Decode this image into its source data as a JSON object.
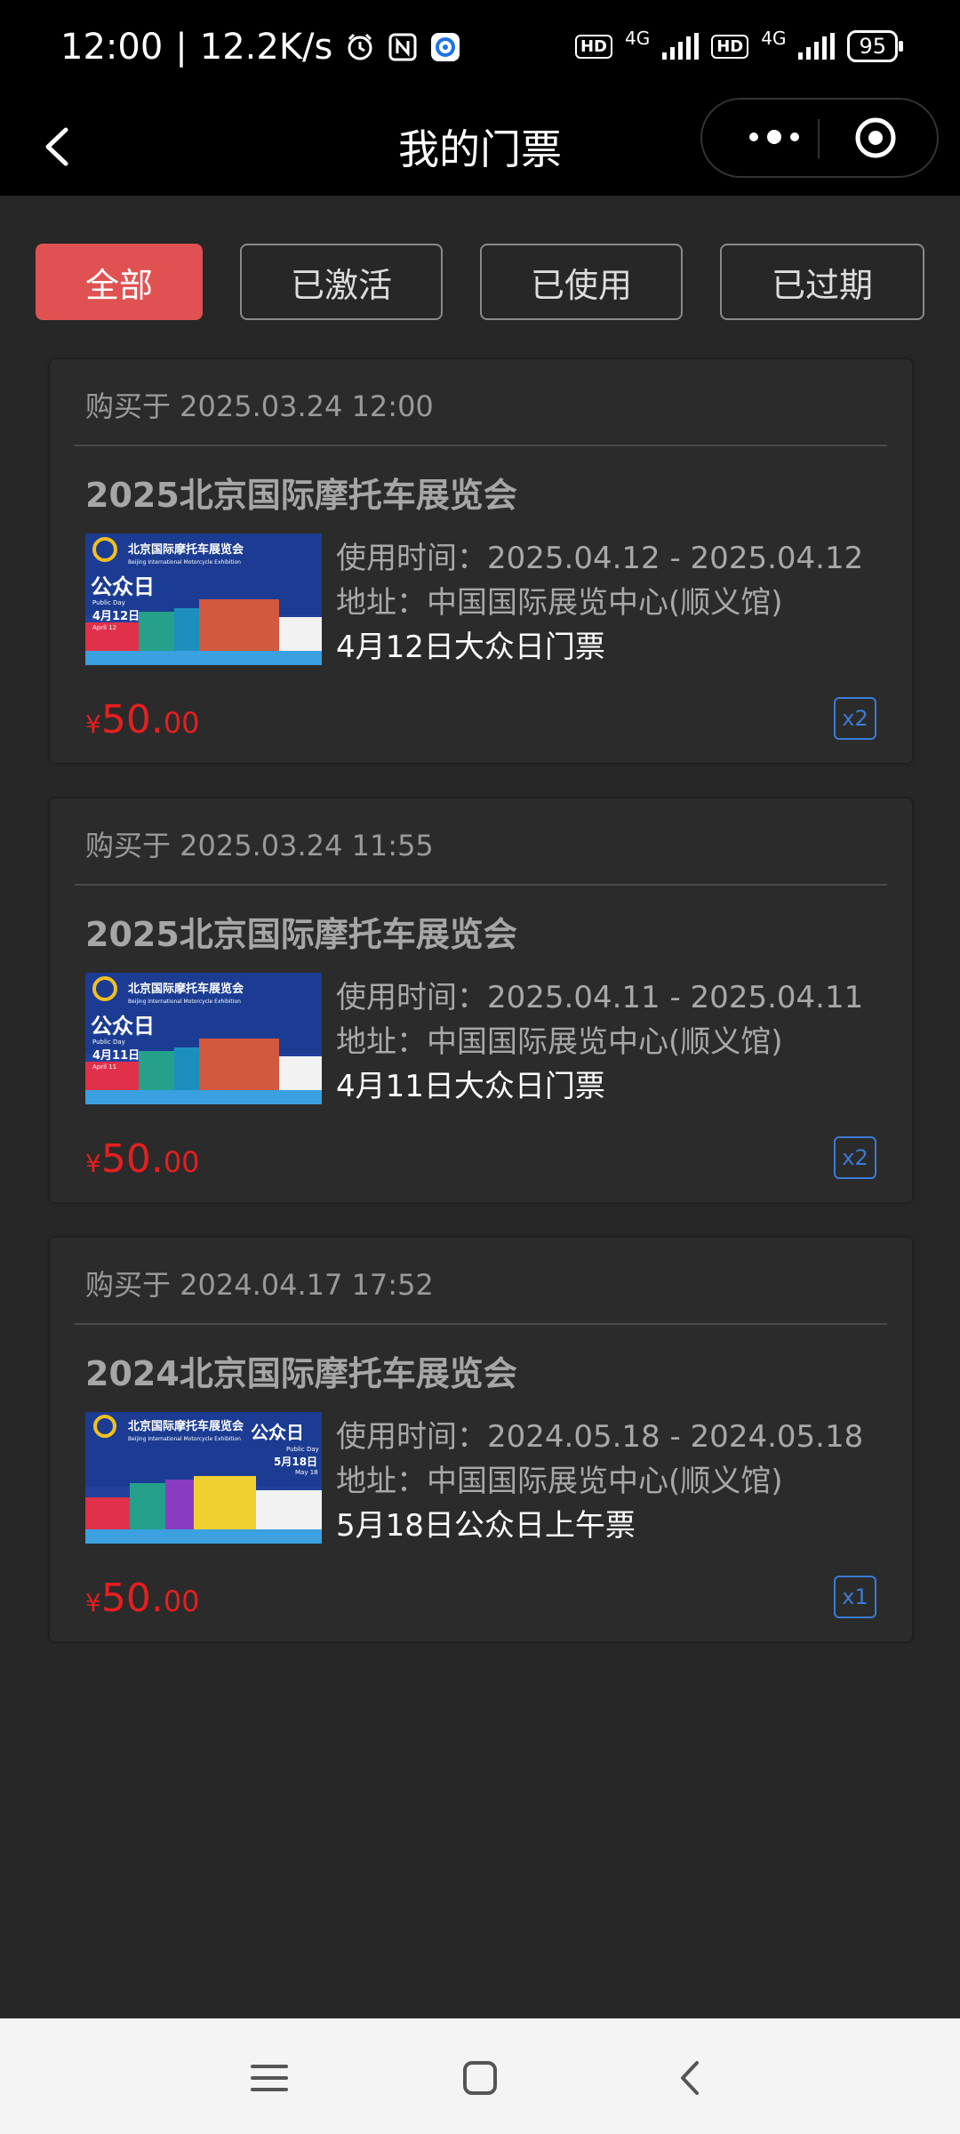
{
  "status_bar": {
    "time": "12:00",
    "net_speed": "12.2K/s",
    "network_1": "4G",
    "network_2": "4G",
    "hd": "HD",
    "battery": "95"
  },
  "header": {
    "title": "我的门票"
  },
  "tabs": [
    {
      "label": "全部",
      "active": true
    },
    {
      "label": "已激活",
      "active": false
    },
    {
      "label": "已使用",
      "active": false
    },
    {
      "label": "已过期",
      "active": false
    }
  ],
  "tickets": [
    {
      "purchase": "购买于 2025.03.24 12:00",
      "title": "2025北京国际摩托车展览会",
      "usage": "使用时间：2025.04.12 - 2025.04.12",
      "address": "地址：中国国际展览中心(顺义馆)",
      "desc": "4月12日大众日门票",
      "price_symbol": "¥",
      "price_int": "50.",
      "price_dec": "00",
      "qty": "x2",
      "thumb": {
        "header": "北京国际摩托车展览会",
        "sub": "Beijing International Motorcycle Exhibition",
        "day": "公众日",
        "day_en": "Public Day",
        "date": "4月12日",
        "date_en": "April 12"
      }
    },
    {
      "purchase": "购买于 2025.03.24 11:55",
      "title": "2025北京国际摩托车展览会",
      "usage": "使用时间：2025.04.11 - 2025.04.11",
      "address": "地址：中国国际展览中心(顺义馆)",
      "desc": "4月11日大众日门票",
      "price_symbol": "¥",
      "price_int": "50.",
      "price_dec": "00",
      "qty": "x2",
      "thumb": {
        "header": "北京国际摩托车展览会",
        "sub": "Beijing International Motorcycle Exhibition",
        "day": "公众日",
        "day_en": "Public Day",
        "date": "4月11日",
        "date_en": "April 11"
      }
    },
    {
      "purchase": "购买于 2024.04.17 17:52",
      "title": "2024北京国际摩托车展览会",
      "usage": "使用时间：2024.05.18 - 2024.05.18",
      "address": "地址：中国国际展览中心(顺义馆)",
      "desc": "5月18日公众日上午票",
      "price_symbol": "¥",
      "price_int": "50.",
      "price_dec": "00",
      "qty": "x1",
      "thumb": {
        "header": "北京国际摩托车展览会",
        "sub": "Beijing International Motorcycle Exhibition",
        "day": "公众日",
        "day_en": "Public Day",
        "date": "5月18日",
        "date_en": "May 18"
      }
    }
  ],
  "colors": {
    "accent": "#e05252",
    "price": "#e51f1f",
    "qty_badge": "#3a7bd5",
    "background": "#272727",
    "card": "#2b2b2b"
  }
}
